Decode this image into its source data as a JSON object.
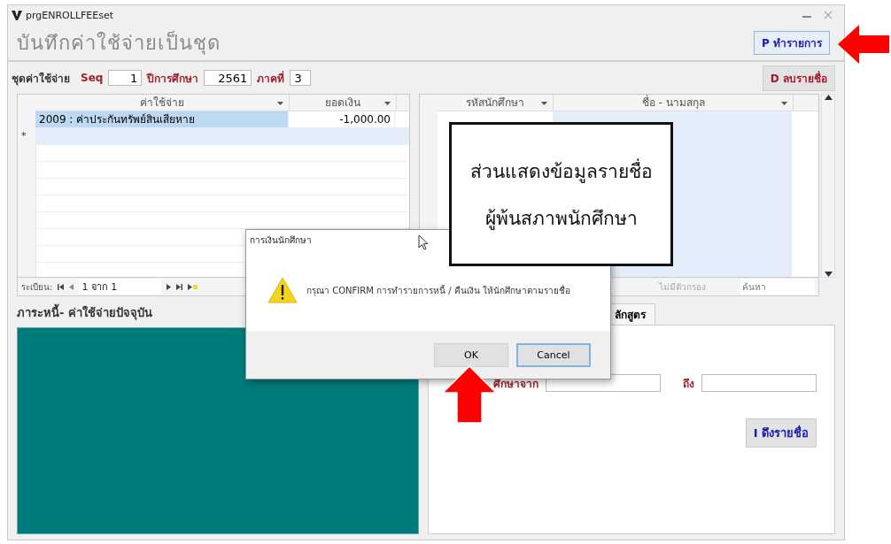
{
  "window": {
    "title": "prgENROLLFEEset"
  },
  "header": {
    "title": "บันทึกค่าใช้จ่ายเป็นชุด",
    "action_button": "P ทำรายการ"
  },
  "filters": {
    "label": "ชุดค่าใช้จ่าย",
    "fields": [
      {
        "label": "Seq",
        "value": "1"
      },
      {
        "label": "ปีการศึกษา",
        "value": "2561"
      },
      {
        "label": "ภาคที่",
        "value": "3"
      }
    ],
    "delete_button": "D ลบรายชื่อ"
  },
  "fee_table": {
    "columns": [
      "ค่าใช้จ่าย",
      "ยอดเงิน"
    ],
    "rows": [
      {
        "cells": [
          "2009 : ค่าประกันทรัพย์สินเสียหาย",
          "-1,000.00"
        ],
        "selected": true
      }
    ],
    "new_row_marker": "*",
    "navigator": {
      "label": "ระเบียน:",
      "position": "1 จาก 1"
    }
  },
  "student_table": {
    "columns": [
      "รหัสนักศึกษา",
      "ชื่อ - นามสกุล"
    ],
    "navigator": {
      "filter": "ไม่มีตัวกรอง",
      "search_placeholder": "ค้นหา"
    }
  },
  "debt_section": {
    "title": "ภาระหนี้- ค่าใช้จ่ายปัจจุบัน"
  },
  "criteria_panel": {
    "tab": "ลักสูตร",
    "from_label": "ศึกษาจาก",
    "to_label": "ถึง",
    "fetch_button": "I ดึงรายชื่อ"
  },
  "dialog": {
    "title": "การเงินนักศึกษา",
    "message": "กรุณา CONFIRM การทำรายการหนี้ / คืนเงิน ให้นักศึกษาตามรายชื่อ",
    "buttons": [
      {
        "label": "OK",
        "focused": false
      },
      {
        "label": "Cancel",
        "focused": true
      }
    ]
  },
  "callout": {
    "lines": [
      "ส่วนแสดงข้อมูลรายชื่อ",
      "ผู้พ้นสภาพนักศึกษา"
    ]
  }
}
